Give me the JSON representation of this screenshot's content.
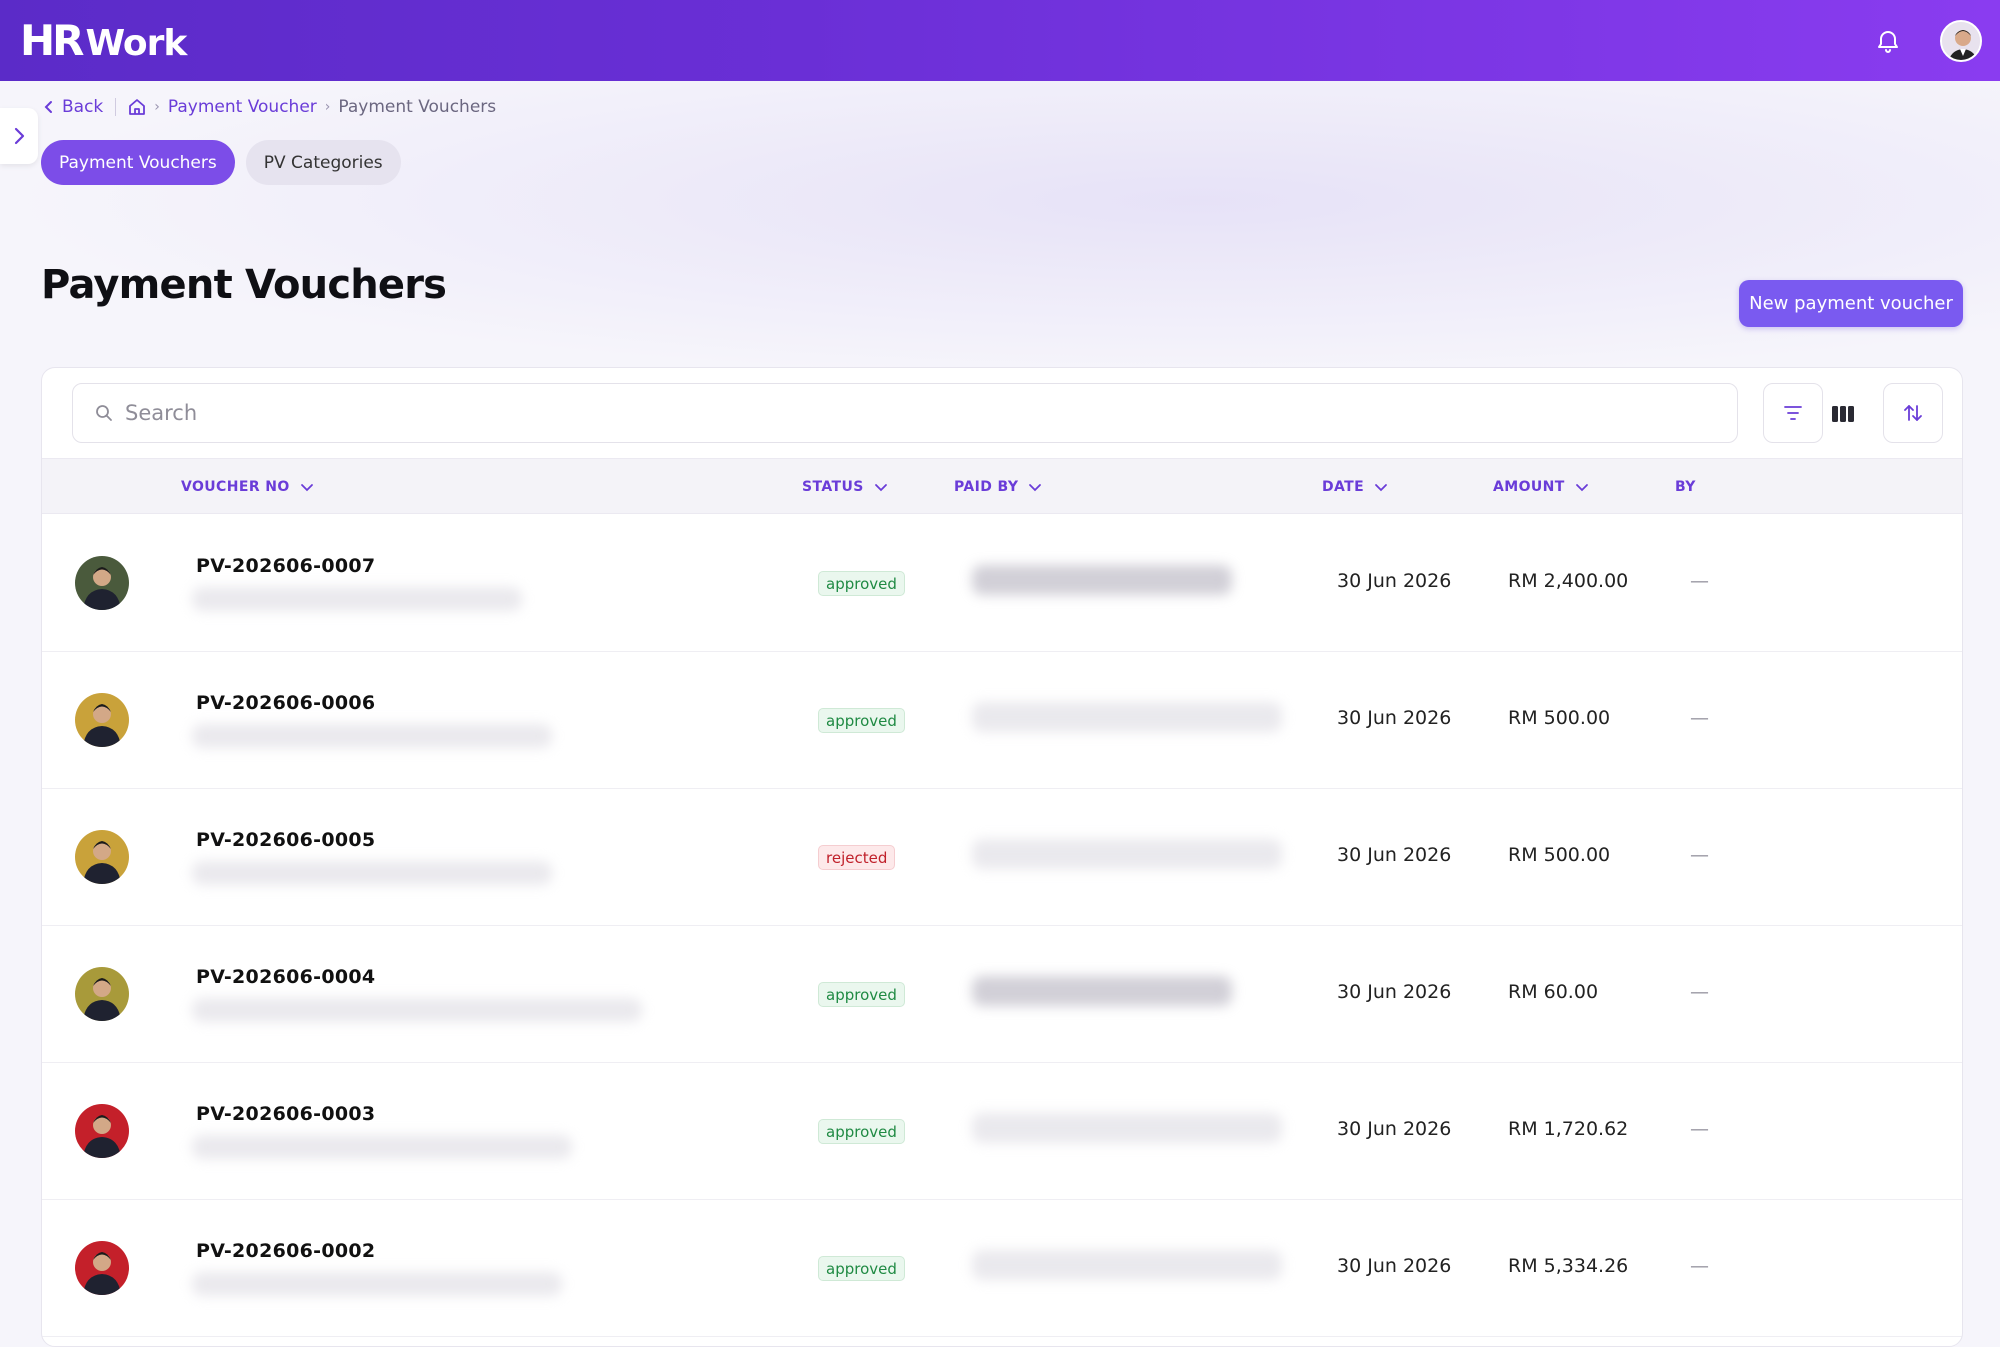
{
  "app": {
    "logo_hr": "HR",
    "logo_work": "Work"
  },
  "breadcrumb": {
    "back": "Back",
    "items": [
      "Payment Voucher",
      "Payment Vouchers"
    ]
  },
  "tabs": [
    {
      "label": "Payment Vouchers",
      "active": true
    },
    {
      "label": "PV Categories",
      "active": false
    }
  ],
  "page": {
    "title": "Payment Vouchers",
    "new_button": "New payment voucher"
  },
  "search": {
    "placeholder": "Search"
  },
  "table": {
    "columns": {
      "voucher_no": "VOUCHER NO",
      "status": "STATUS",
      "paid_by": "PAID BY",
      "date": "DATE",
      "amount": "AMOUNT",
      "by": "BY"
    },
    "rows": [
      {
        "voucher_no": "PV-202606-0007",
        "status": "approved",
        "date": "30 Jun 2026",
        "amount": "RM 2,400.00",
        "by": "—",
        "avatar_color": "#4a5a3c"
      },
      {
        "voucher_no": "PV-202606-0006",
        "status": "approved",
        "date": "30 Jun 2026",
        "amount": "RM 500.00",
        "by": "—",
        "avatar_color": "#c9a23a"
      },
      {
        "voucher_no": "PV-202606-0005",
        "status": "rejected",
        "date": "30 Jun 2026",
        "amount": "RM 500.00",
        "by": "—",
        "avatar_color": "#c9a23a"
      },
      {
        "voucher_no": "PV-202606-0004",
        "status": "approved",
        "date": "30 Jun 2026",
        "amount": "RM 60.00",
        "by": "—",
        "avatar_color": "#a89a3a"
      },
      {
        "voucher_no": "PV-202606-0003",
        "status": "approved",
        "date": "30 Jun 2026",
        "amount": "RM 1,720.62",
        "by": "—",
        "avatar_color": "#c4202a"
      },
      {
        "voucher_no": "PV-202606-0002",
        "status": "approved",
        "date": "30 Jun 2026",
        "amount": "RM 5,334.26",
        "by": "—",
        "avatar_color": "#c4202a"
      }
    ]
  },
  "colors": {
    "brand": "#7c4de8",
    "approved": "#1f8a43",
    "rejected": "#c0212b"
  }
}
